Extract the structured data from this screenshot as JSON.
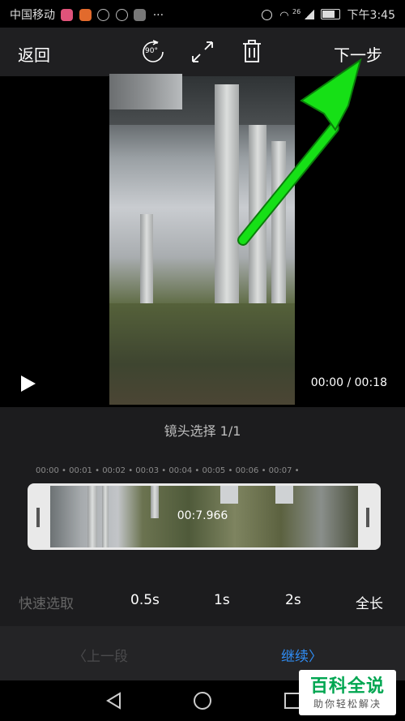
{
  "status_bar": {
    "carrier": "中国移动",
    "more": "···",
    "network": "26",
    "time": "下午3:45"
  },
  "toolbar": {
    "back_label": "返回",
    "rotate_label": "90°",
    "next_label": "下一步"
  },
  "player": {
    "time_readout": "00:00 / 00:18"
  },
  "selection": {
    "title": "镜头选择 1/1",
    "ruler_ticks": [
      "00:00",
      "00:01",
      "00:02",
      "00:03",
      "00:04",
      "00:05",
      "00:06",
      "00:07"
    ],
    "trim_duration": "00:7.966"
  },
  "quick_select": {
    "label": "快速选取",
    "options": [
      "0.5s",
      "1s",
      "2s",
      "全长"
    ]
  },
  "nav": {
    "prev_label": "上一段",
    "continue_label": "继续"
  },
  "watermark": {
    "top": "百科全说",
    "bottom": "助你轻松解决"
  },
  "colors": {
    "accent_blue": "#2f8cf3",
    "arrow_green": "#16e016",
    "watermark_green": "#00a651"
  }
}
